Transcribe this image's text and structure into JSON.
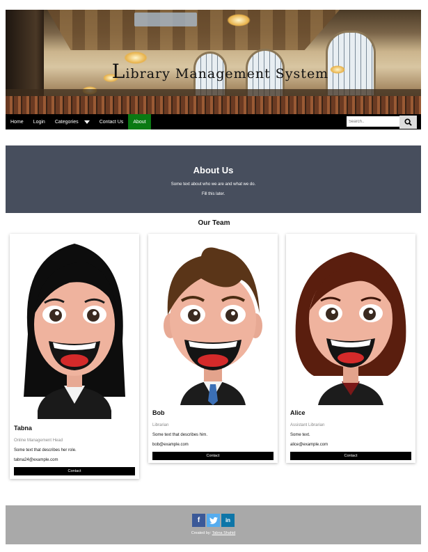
{
  "banner": {
    "title_initial": "L",
    "title_rest": "ibrary Management System"
  },
  "nav": {
    "items": [
      {
        "label": "Home"
      },
      {
        "label": "Login"
      },
      {
        "label": "Categories"
      },
      {
        "label": "Contact Us"
      },
      {
        "label": "About"
      }
    ],
    "active": "About",
    "active_color": "#0a7a13",
    "search_placeholder": "Search.."
  },
  "about": {
    "title": "About Us",
    "line1": "Some text about who we are and what we do.",
    "line2": "Fill this later.",
    "bg_color": "#474e5d"
  },
  "team": {
    "title": "Our Team",
    "members": [
      {
        "name": "Tabna",
        "role": "Online Management Head",
        "text": "Some text that describes her role.",
        "email": "tabna24@example.com",
        "button": "Contact"
      },
      {
        "name": "Bob",
        "role": "Librarian",
        "text": "Some text that describes him.",
        "email": "bob@example.com",
        "button": "Contact"
      },
      {
        "name": "Alice",
        "role": "Assistant Librarian",
        "text": "Some text.",
        "email": "alice@example.com",
        "button": "Contact"
      }
    ]
  },
  "footer": {
    "social": [
      "f",
      "t",
      "in"
    ],
    "credit_prefix": "Created by:",
    "credit_name": "Tabna Shahid",
    "bg_color": "#a9a9a9"
  }
}
